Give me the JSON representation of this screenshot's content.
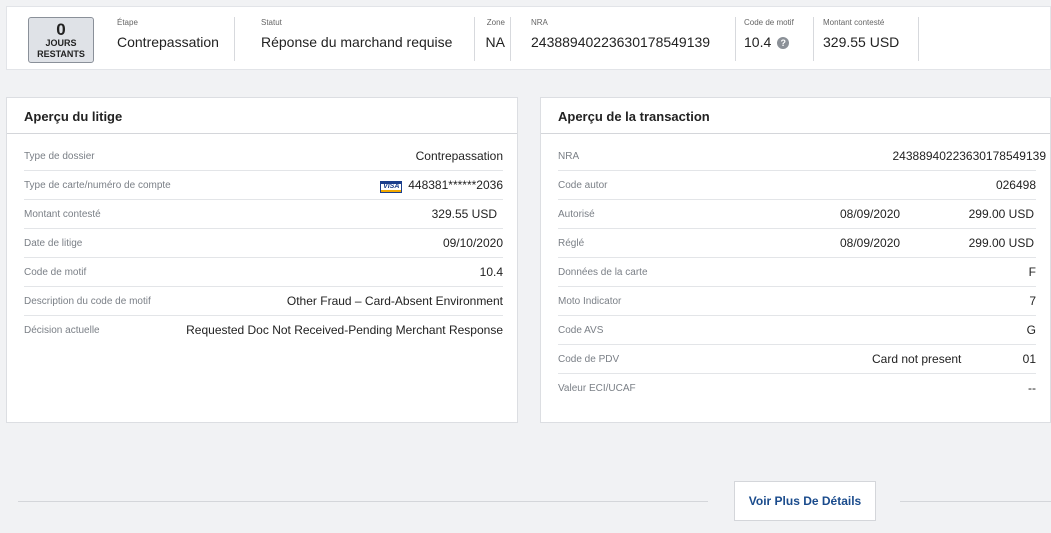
{
  "header": {
    "days_count": "0",
    "days_label_1": "JOURS",
    "days_label_2": "RESTANTS",
    "etape_label": "Étape",
    "etape_value": "Contrepassation",
    "statut_label": "Statut",
    "statut_value": "Réponse du marchand requise",
    "zone_label": "Zone",
    "zone_value": "NA",
    "nra_label": "NRA",
    "nra_value": "24388940223630178549139",
    "motif_label": "Code de motif",
    "motif_value": "10.4",
    "montant_label": "Montant contesté",
    "montant_value": "329.55 USD"
  },
  "litige": {
    "title": "Aperçu du litige",
    "card_brand": "VISA",
    "rows": [
      {
        "label": "Type de dossier",
        "value": "Contrepassation"
      },
      {
        "label": "Type de carte/numéro de compte",
        "value": "448381******2036"
      },
      {
        "label": "Montant contesté",
        "value": "329.55 USD"
      },
      {
        "label": "Date de litige",
        "value": "09/10/2020"
      },
      {
        "label": "Code de motif",
        "value": "10.4"
      },
      {
        "label": "Description du code de motif",
        "value": "Other Fraud – Card-Absent Environment"
      },
      {
        "label": "Décision actuelle",
        "value": "Requested Doc Not Received-Pending Merchant Response"
      }
    ]
  },
  "transaction": {
    "title": "Aperçu de la transaction",
    "rows": [
      {
        "label": "NRA",
        "value": "24388940223630178549139"
      },
      {
        "label": "Code autor",
        "value": "026498"
      },
      {
        "label": "Autorisé",
        "date": "08/09/2020",
        "value": "299.00 USD"
      },
      {
        "label": "Réglé",
        "date": "08/09/2020",
        "value": "299.00 USD"
      },
      {
        "label": "Données de la carte",
        "value": "F"
      },
      {
        "label": "Moto Indicator",
        "value": "7"
      },
      {
        "label": "Code AVS",
        "value": "G"
      },
      {
        "label": "Code de PDV",
        "date": "Card not present",
        "value": "01"
      },
      {
        "label": "Valeur ECI/UCAF",
        "value": "--"
      }
    ]
  },
  "footer": {
    "more_button": "Voir Plus De Détails"
  }
}
